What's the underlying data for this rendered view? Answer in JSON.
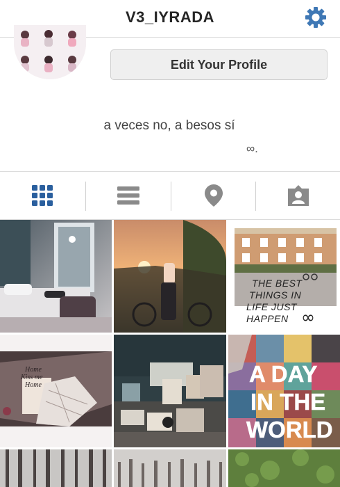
{
  "header": {
    "username": "V3_IYRADA",
    "settings_icon": "gear-icon"
  },
  "profile": {
    "edit_button_label": "Edit Your Profile"
  },
  "bio": {
    "line1": "a veces no, a besos sí",
    "line2": "∞."
  },
  "tabs": [
    {
      "name": "grid-view",
      "icon": "grid-icon",
      "active": true
    },
    {
      "name": "list-view",
      "icon": "list-icon",
      "active": false
    },
    {
      "name": "photo-map",
      "icon": "location-pin-icon",
      "active": false
    },
    {
      "name": "tagged-photos",
      "icon": "tagged-person-icon",
      "active": false
    }
  ],
  "posts": {
    "post3_caption_lines": [
      "THE BEST",
      "THINGS IN",
      "LIFE JUST",
      "HAPPEN"
    ],
    "post3_symbol": "∞",
    "post4_text_lines": [
      "Home",
      "Kiss me",
      "Home"
    ],
    "post6_text_lines": [
      "A DAY",
      "IN THE",
      "WORLD"
    ]
  },
  "colors": {
    "accent": "#3f78b5",
    "tab_icon": "#8a8a8a",
    "active_tab": "#2a5f9e",
    "text": "#262626"
  }
}
